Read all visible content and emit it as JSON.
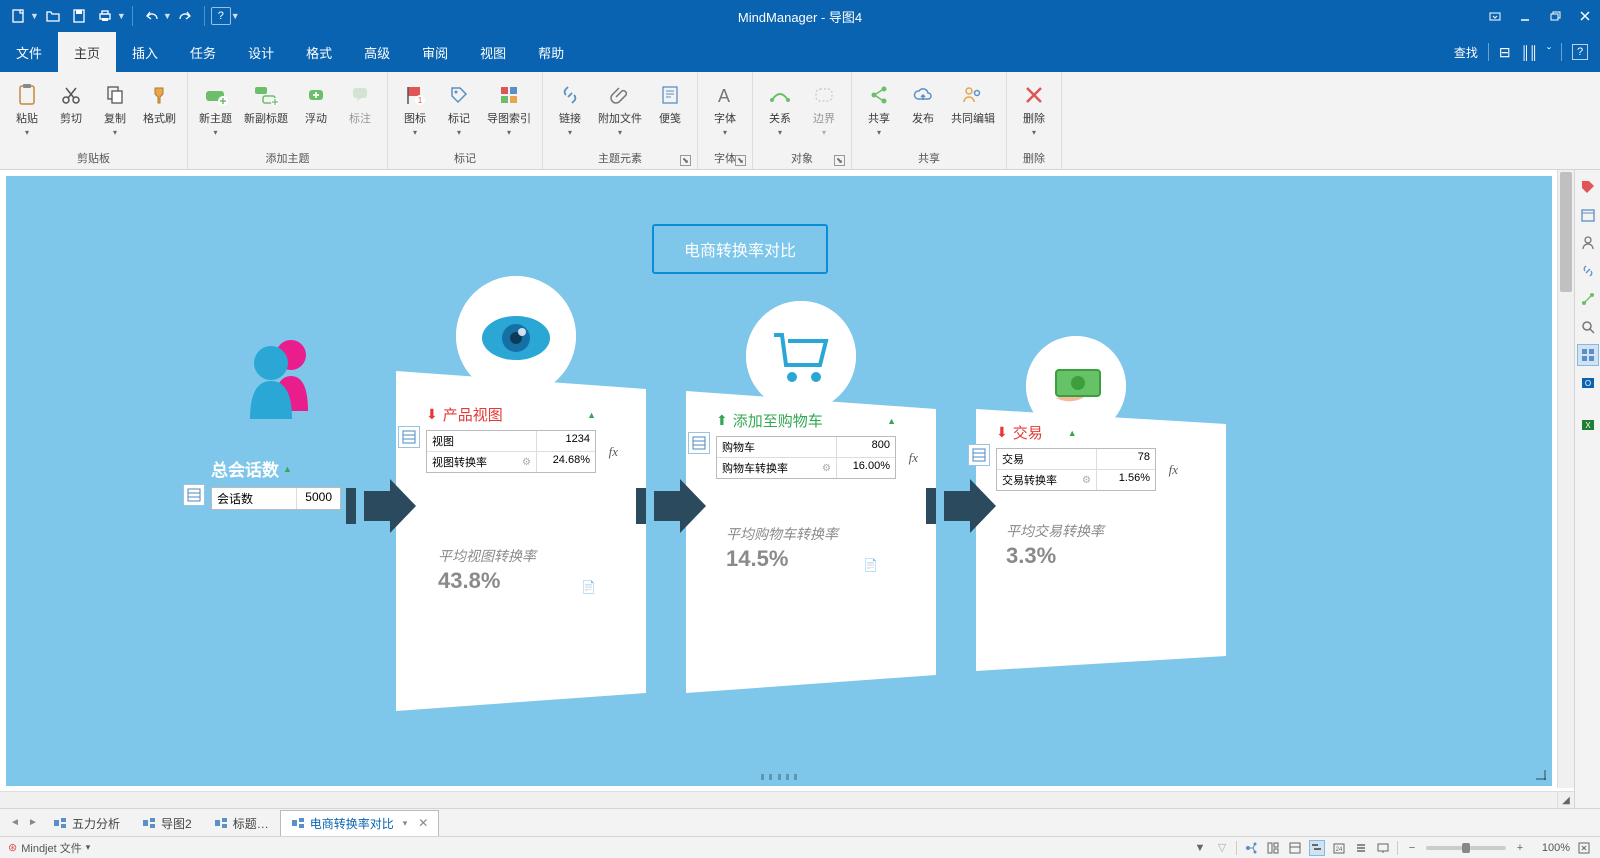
{
  "app_title": "MindManager - 导图4",
  "qat": {
    "new": "新建",
    "open": "打开",
    "save": "保存",
    "print": "打印",
    "undo": "撤销",
    "redo": "重做",
    "help": "?"
  },
  "menus": [
    "文件",
    "主页",
    "插入",
    "任务",
    "设计",
    "格式",
    "高级",
    "审阅",
    "视图",
    "帮助"
  ],
  "menu_right": {
    "search": "查找"
  },
  "ribbon": {
    "groups": {
      "clipboard": {
        "label": "剪贴板",
        "paste": "粘贴",
        "cut": "剪切",
        "copy": "复制",
        "format_painter": "格式刷"
      },
      "add_topic": {
        "label": "添加主题",
        "new_topic": "新主题",
        "sub_topic": "新副标题",
        "floating": "浮动",
        "annotation": "标注"
      },
      "markers": {
        "label": "标记",
        "icon": "图标",
        "tag": "标记",
        "mapindex": "导图索引"
      },
      "topic_elements": {
        "label": "主题元素",
        "link": "链接",
        "attach": "附加文件",
        "note": "便笺"
      },
      "font": {
        "label": "字体",
        "font": "字体"
      },
      "object": {
        "label": "对象",
        "relation": "关系",
        "boundary": "边界"
      },
      "share": {
        "label": "共享",
        "share": "共享",
        "publish": "发布",
        "coedit": "共同编辑"
      },
      "delete": {
        "label": "删除",
        "delete": "删除"
      }
    }
  },
  "diagram": {
    "title": "电商转换率对比",
    "total": {
      "title": "总会话数",
      "k": "会话数",
      "v": "5000"
    },
    "step1": {
      "title": "产品视图",
      "row1": {
        "k": "视图",
        "v": "1234"
      },
      "row2": {
        "k": "视图转换率",
        "v": "24.68%"
      },
      "avg_label": "平均视图转换率",
      "avg_value": "43.8%"
    },
    "step2": {
      "title": "添加至购物车",
      "row1": {
        "k": "购物车",
        "v": "800"
      },
      "row2": {
        "k": "购物车转换率",
        "v": "16.00%"
      },
      "avg_label": "平均购物车转换率",
      "avg_value": "14.5%"
    },
    "step3": {
      "title": "交易",
      "row1": {
        "k": "交易",
        "v": "78"
      },
      "row2": {
        "k": "交易转换率",
        "v": "1.56%"
      },
      "avg_label": "平均交易转换率",
      "avg_value": "3.3%"
    },
    "fx": "fx"
  },
  "doctabs": {
    "tabs": [
      {
        "label": "五力分析"
      },
      {
        "label": "导图2"
      },
      {
        "label": "标题…"
      },
      {
        "label": "电商转换率对比"
      }
    ]
  },
  "status": {
    "left": "Mindjet 文件",
    "zoom": "100%"
  }
}
